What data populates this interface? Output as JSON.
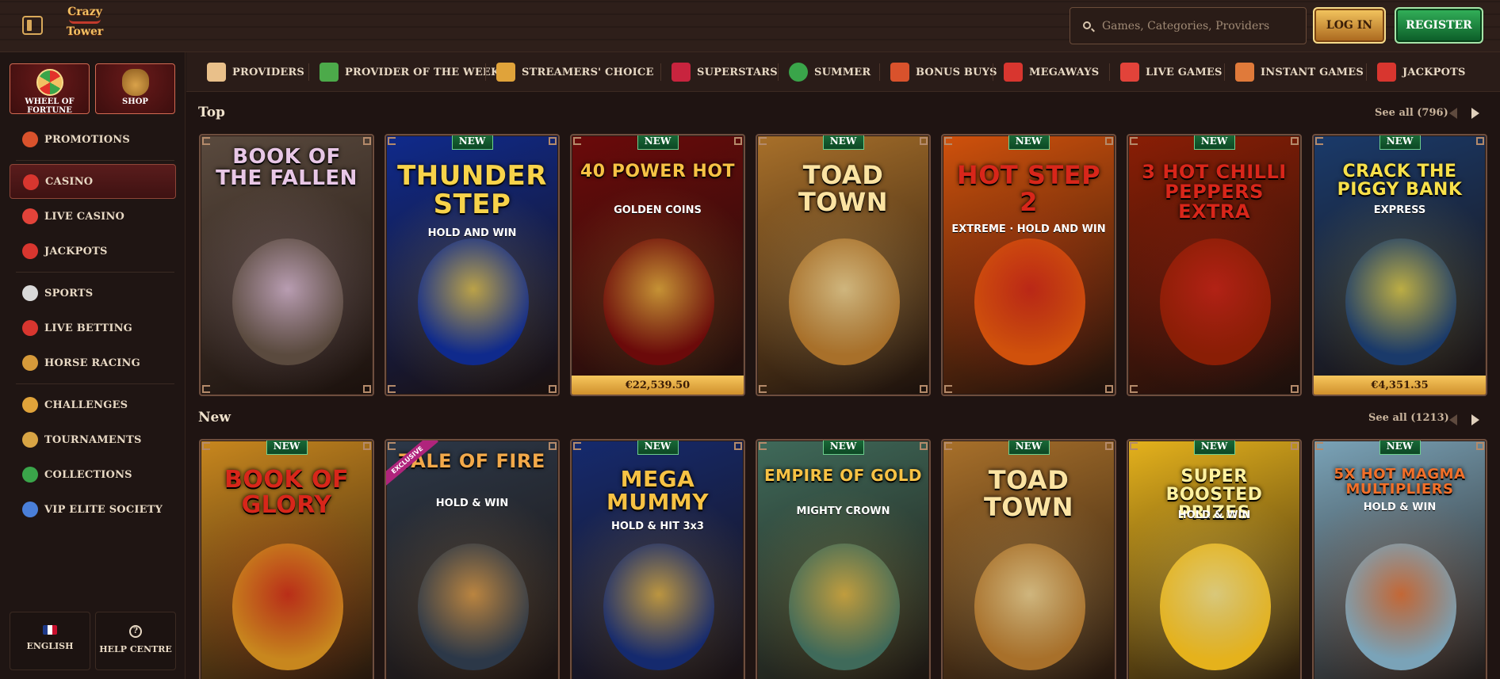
{
  "header": {
    "logo_line1": "Crazy",
    "logo_line2": "Tower",
    "search_placeholder": "Games, Categories, Providers",
    "login_label": "LOG IN",
    "register_label": "REGISTER"
  },
  "sidebar": {
    "quick": [
      {
        "label": "WHEEL OF FORTUNE",
        "icon": "wheel-of-fortune-icon"
      },
      {
        "label": "SHOP",
        "icon": "shop-bag-icon"
      }
    ],
    "items": [
      {
        "label": "PROMOTIONS",
        "icon": "gift-icon",
        "color": "#d9522c"
      },
      {
        "label": "CASINO",
        "icon": "cherry-icon",
        "color": "#d8362f",
        "active": true
      },
      {
        "label": "LIVE CASINO",
        "icon": "roulette-chip-icon",
        "color": "#e2433a"
      },
      {
        "label": "JACKPOTS",
        "icon": "seven-icon",
        "color": "#d8362f"
      },
      {
        "label": "SPORTS",
        "icon": "soccer-ball-icon",
        "color": "#d9d9d9"
      },
      {
        "label": "LIVE BETTING",
        "icon": "live-icon",
        "color": "#d8362f"
      },
      {
        "label": "HORSE RACING",
        "icon": "horse-icon",
        "color": "#d69a3a"
      },
      {
        "label": "CHALLENGES",
        "icon": "medal-icon",
        "color": "#e0a33a"
      },
      {
        "label": "TOURNAMENTS",
        "icon": "trophy-icon",
        "color": "#d8a444"
      },
      {
        "label": "COLLECTIONS",
        "icon": "cards-icon",
        "color": "#3aa54a"
      },
      {
        "label": "VIP ELITE SOCIETY",
        "icon": "diamond-icon",
        "color": "#4a7fd9"
      }
    ],
    "language_label": "ENGLISH",
    "help_label": "HELP CENTRE"
  },
  "categories": [
    {
      "label": "PROVIDERS",
      "icon": "scroll-icon",
      "color": "#e9c08a"
    },
    {
      "label": "PROVIDER OF THE WEEK",
      "icon": "card-icon",
      "color": "#4caa4a"
    },
    {
      "label": "STREAMERS' CHOICE",
      "icon": "lightning-icon",
      "color": "#e0a33a"
    },
    {
      "label": "SUPERSTARS",
      "icon": "gem-icon",
      "color": "#c8243e"
    },
    {
      "label": "SUMMER",
      "icon": "watermelon-icon",
      "color": "#3aa54a"
    },
    {
      "label": "BONUS BUYS",
      "icon": "gift-box-icon",
      "color": "#d9522c"
    },
    {
      "label": "MEGAWAYS",
      "icon": "megaways-m-icon",
      "color": "#d8362f"
    },
    {
      "label": "LIVE GAMES",
      "icon": "roulette-icon",
      "color": "#e2433a"
    },
    {
      "label": "INSTANT GAMES",
      "icon": "joystick-icon",
      "color": "#e07a3a"
    },
    {
      "label": "JACKPOTS",
      "icon": "seven-icon",
      "color": "#d8362f"
    }
  ],
  "sections": [
    {
      "title": "Top",
      "see_all": "See all (796)",
      "games": [
        {
          "title": "BOOK OF THE FALLEN",
          "new": false,
          "jackpot": "",
          "bg": "#5a4a3e",
          "accent": "#e8c7e6",
          "size": 26
        },
        {
          "title": "THUNDER STEP",
          "sub": "HOLD AND WIN",
          "new": true,
          "jackpot": "",
          "bg": "#0f2a8c",
          "accent": "#f7d34a",
          "size": 34
        },
        {
          "title": "40 POWER HOT",
          "sub": "GOLDEN COINS",
          "new": true,
          "jackpot": "€22,539.50",
          "bg": "#6b0a0a",
          "accent": "#f7c244",
          "size": 22
        },
        {
          "title": "TOAD TOWN",
          "new": true,
          "jackpot": "",
          "bg": "#a8702a",
          "accent": "#fbe3a2",
          "size": 32
        },
        {
          "title": "HOT STEP 2",
          "sub": "EXTREME · HOLD AND WIN",
          "new": true,
          "jackpot": "",
          "bg": "#d0510c",
          "accent": "#d8261a",
          "size": 32
        },
        {
          "title": "3 HOT CHILLI PEPPERS EXTRA",
          "new": true,
          "jackpot": "",
          "bg": "#8a1e05",
          "accent": "#d8261a",
          "size": 24
        },
        {
          "title": "CRACK THE PIGGY BANK",
          "sub": "EXPRESS",
          "new": true,
          "jackpot": "€4,351.35",
          "bg": "#1a3a6a",
          "accent": "#f7e04a",
          "size": 22
        }
      ]
    },
    {
      "title": "New",
      "see_all": "See all (1213)",
      "games": [
        {
          "title": "BOOK OF GLORY",
          "new": true,
          "exclusive": "",
          "bg": "#c8871e",
          "accent": "#d8261a",
          "size": 30
        },
        {
          "title": "TALE OF FIRE",
          "sub": "HOLD & WIN",
          "new": false,
          "exclusive": "EXCLUSIVE",
          "bg": "#2c3848",
          "accent": "#f2a94a",
          "size": 24
        },
        {
          "title": "MEGA MUMMY",
          "sub": "HOLD & HIT 3x3",
          "new": true,
          "exclusive": "",
          "bg": "#152a6e",
          "accent": "#f7c244",
          "size": 28
        },
        {
          "title": "EMPIRE OF GOLD",
          "sub": "MIGHTY CROWN",
          "new": true,
          "exclusive": "",
          "bg": "#3f6a5a",
          "accent": "#f7c244",
          "size": 20
        },
        {
          "title": "TOAD TOWN",
          "new": true,
          "exclusive": "",
          "bg": "#a8702a",
          "accent": "#fbe3a2",
          "size": 32
        },
        {
          "title": "SUPER BOOSTED PRIZES",
          "sub": "HOLD & WIN",
          "new": true,
          "exclusive": "",
          "bg": "#e5b21c",
          "accent": "#fff2a0",
          "size": 22
        },
        {
          "title": "5X HOT MAGMA MULTIPLIERS",
          "sub": "HOLD & WIN",
          "new": true,
          "exclusive": "",
          "bg": "#7aa3b8",
          "accent": "#f2702a",
          "size": 18
        }
      ]
    }
  ],
  "new_badge": "NEW"
}
